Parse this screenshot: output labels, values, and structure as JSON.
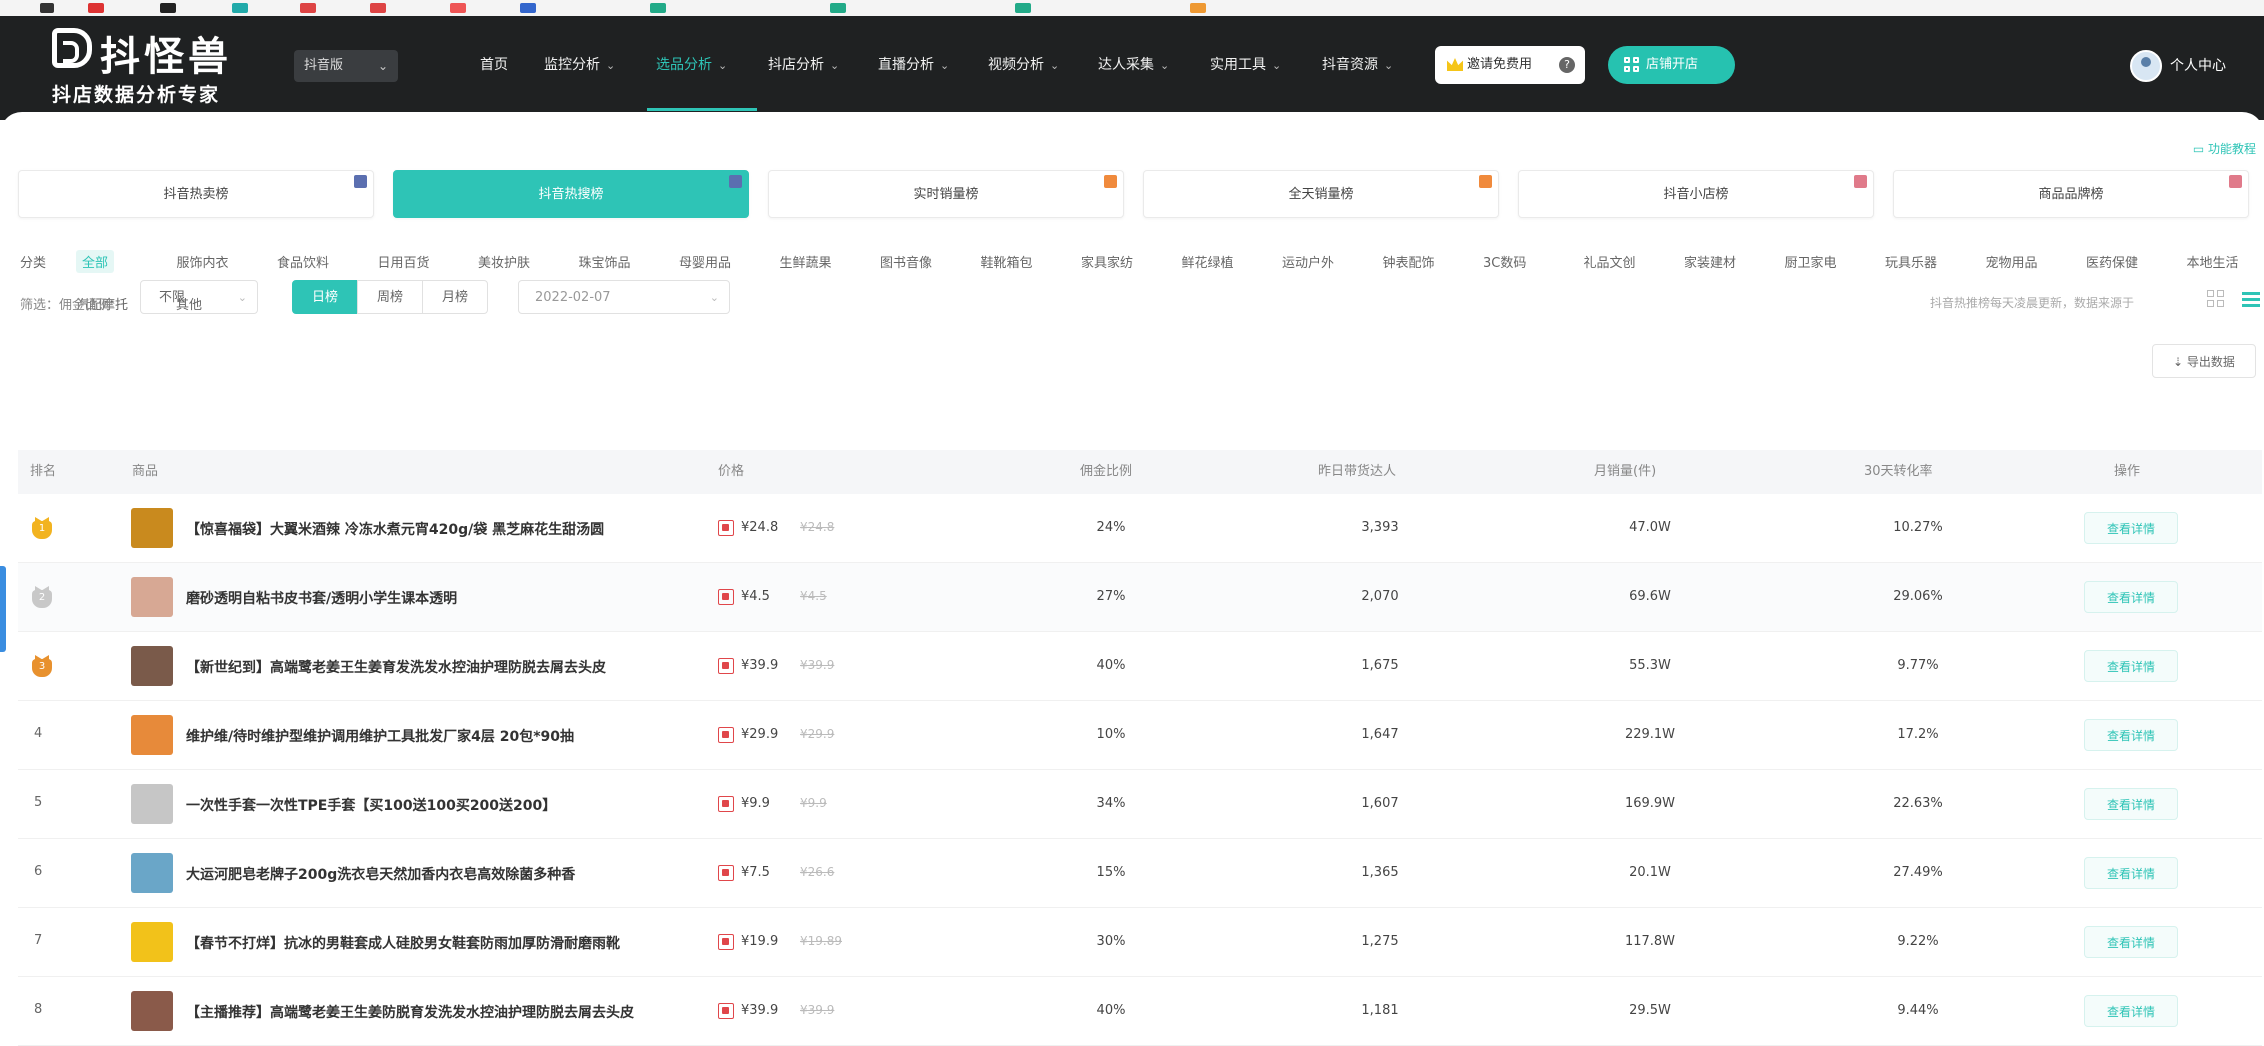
{
  "header": {
    "logo_text": "抖怪兽",
    "logo_sub": "抖店数据分析专家",
    "platform": "抖音版",
    "nav": [
      {
        "label": "首页",
        "active": false,
        "chevron": false
      },
      {
        "label": "监控分析",
        "active": false,
        "chevron": true
      },
      {
        "label": "选品分析",
        "active": true,
        "chevron": true
      },
      {
        "label": "抖店分析",
        "active": false,
        "chevron": true
      },
      {
        "label": "直播分析",
        "active": false,
        "chevron": true
      },
      {
        "label": "视频分析",
        "active": false,
        "chevron": true
      },
      {
        "label": "达人采集",
        "active": false,
        "chevron": true
      },
      {
        "label": "实用工具",
        "active": false,
        "chevron": true
      },
      {
        "label": "抖音资源",
        "active": false,
        "chevron": true
      }
    ],
    "vip_label": "邀请免费用",
    "app_label": "店铺开店",
    "user_label": "个人中心"
  },
  "feature_link": "功能教程",
  "rank_tabs": [
    {
      "label": "抖音热卖榜",
      "active": false,
      "corner_color": "#5b6fb0"
    },
    {
      "label": "抖音热搜榜",
      "active": true,
      "corner_color": "#5b6fb0"
    },
    {
      "label": "实时销量榜",
      "active": false,
      "corner_color": "#f08a3c"
    },
    {
      "label": "全天销量榜",
      "active": false,
      "corner_color": "#f08a3c"
    },
    {
      "label": "抖音小店榜",
      "active": false,
      "corner_color": "#e07a8a"
    },
    {
      "label": "商品品牌榜",
      "active": false,
      "corner_color": "#e07a8a"
    }
  ],
  "categories_label": "分类",
  "categories": [
    "全部",
    "服饰内衣",
    "食品饮料",
    "日用百货",
    "美妆护肤",
    "珠宝饰品",
    "母婴用品",
    "生鲜蔬果",
    "图书音像",
    "鞋靴箱包",
    "家具家纺",
    "鲜花绿植",
    "运动户外",
    "钟表配饰",
    "3C数码",
    "礼品文创",
    "家装建材",
    "厨卫家电",
    "玩具乐器",
    "宠物用品",
    "医药保健",
    "本地生活",
    "汽配摩托",
    "其他"
  ],
  "export_label": "导出数据",
  "filter": {
    "label": "筛选：佣金比例",
    "value": "不限",
    "periods": [
      {
        "label": "日榜",
        "active": true
      },
      {
        "label": "周榜",
        "active": false
      },
      {
        "label": "月榜",
        "active": false
      }
    ],
    "date": "2022-02-07",
    "tip": "抖音热推榜每天凌晨更新，数据来源于"
  },
  "table": {
    "headers": [
      "排名",
      "商品",
      "价格",
      "佣金比例",
      "昨日带货达人",
      "月销量(件)",
      "30天转化率",
      "操作"
    ],
    "rows": [
      {
        "rank": "1",
        "medal": "gold",
        "thumb": "#c98a1e",
        "name": "【惊喜福袋】大翼米酒辣 冷冻水煮元宵420g/袋 黑芝麻花生甜汤圆",
        "price": "¥24.8",
        "oprice": "¥24.8",
        "commission": "24%",
        "talent": "3,393",
        "sales": "47.0W",
        "conv": "10.27%",
        "action": "查看详情"
      },
      {
        "rank": "2",
        "medal": "silver",
        "thumb": "#d7a894",
        "name": "磨砂透明自粘书皮书套/透明小学生课本透明",
        "price": "¥4.5",
        "oprice": "¥4.5",
        "commission": "27%",
        "talent": "2,070",
        "sales": "69.6W",
        "conv": "29.06%",
        "action": "查看详情"
      },
      {
        "rank": "3",
        "medal": "bronze",
        "thumb": "#7a5a4a",
        "name": "【新世纪到】高端鹭老姜王生姜育发洗发水控油护理防脱去屑去头皮",
        "price": "¥39.9",
        "oprice": "¥39.9",
        "commission": "40%",
        "talent": "1,675",
        "sales": "55.3W",
        "conv": "9.77%",
        "action": "查看详情"
      },
      {
        "rank": "4",
        "medal": "",
        "thumb": "#e78a3a",
        "name": "维护维/待时维护型维护调用维护工具批发厂家4层 20包*90抽",
        "price": "¥29.9",
        "oprice": "¥29.9",
        "commission": "10%",
        "talent": "1,647",
        "sales": "229.1W",
        "conv": "17.2%",
        "action": "查看详情"
      },
      {
        "rank": "5",
        "medal": "",
        "thumb": "#c6c6c6",
        "name": "一次性手套一次性TPE手套【买100送100买200送200】",
        "price": "¥9.9",
        "oprice": "¥9.9",
        "commission": "34%",
        "talent": "1,607",
        "sales": "169.9W",
        "conv": "22.63%",
        "action": "查看详情"
      },
      {
        "rank": "6",
        "medal": "",
        "thumb": "#6aa6c8",
        "name": "大运河肥皂老牌子200g洗衣皂天然加香内衣皂高效除菌多种香",
        "price": "¥7.5",
        "oprice": "¥26.6",
        "commission": "15%",
        "talent": "1,365",
        "sales": "20.1W",
        "conv": "27.49%",
        "action": "查看详情"
      },
      {
        "rank": "7",
        "medal": "",
        "thumb": "#f2c21a",
        "name": "【春节不打烊】抗冰的男鞋套成人硅胶男女鞋套防雨加厚防滑耐磨雨靴",
        "price": "¥19.9",
        "oprice": "¥19.89",
        "commission": "30%",
        "talent": "1,275",
        "sales": "117.8W",
        "conv": "9.22%",
        "action": "查看详情"
      },
      {
        "rank": "8",
        "medal": "",
        "thumb": "#8a5a4a",
        "name": "【主播推荐】高端鹭老姜王生姜防脱育发洗发水控油护理防脱去屑去头皮",
        "price": "¥39.9",
        "oprice": "¥39.9",
        "commission": "40%",
        "talent": "1,181",
        "sales": "29.5W",
        "conv": "9.44%",
        "action": "查看详情"
      }
    ]
  }
}
